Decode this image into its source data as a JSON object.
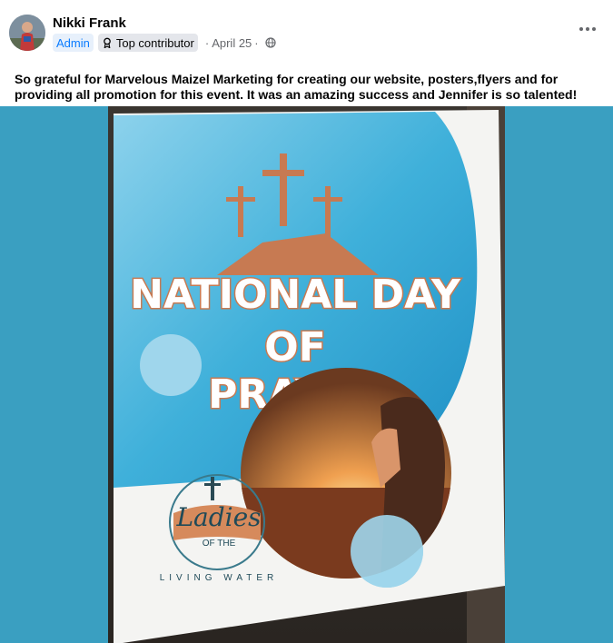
{
  "post": {
    "author": "Nikki Frank",
    "badges": {
      "admin": "Admin",
      "top_contributor": "Top contributor"
    },
    "separator": "·",
    "date": "April 25",
    "text": "So grateful for Marvelous Maizel Marketing for creating our website, posters,flyers and for providing all promotion for this event. It was an amazing success and Jennifer is so talented!"
  },
  "poster": {
    "title_line1": "NATIONAL DAY",
    "title_line2": "OF",
    "title_line3": "PRAYER",
    "logo_main": "Ladies",
    "logo_of_the": "OF THE",
    "logo_bottom": "LIVING WATER"
  },
  "colors": {
    "page_bg": "#ffffff",
    "photo_bg": "#3a9fc1",
    "poster_blue": "#4ab3d8",
    "poster_orange": "#c77a52",
    "admin_blue": "#0a7cff"
  },
  "icons": {
    "top_contributor": "award-ribbon-icon",
    "audience": "globe-icon",
    "more": "more-options-icon"
  }
}
